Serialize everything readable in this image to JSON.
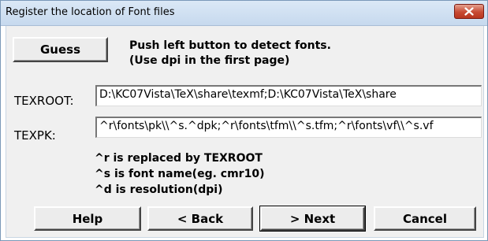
{
  "window": {
    "title": "Register the location of Font files"
  },
  "guess": {
    "button_label": "Guess",
    "hint_line1": "Push left button to detect fonts.",
    "hint_line2": "(Use dpi in the first page)"
  },
  "texroot": {
    "label": "TEXROOT:",
    "value": "D:\\KC07Vista\\TeX\\share\\texmf;D:\\KC07Vista\\TeX\\share"
  },
  "texpk": {
    "label": "TEXPK:",
    "value": "^r\\fonts\\pk\\\\^s.^dpk;^r\\fonts\\tfm\\\\^s.tfm;^r\\fonts\\vf\\\\^s.vf"
  },
  "notes": {
    "line1": "^r is replaced by TEXROOT",
    "line2": "^s is font name(eg. cmr10)",
    "line3": "^d is resolution(dpi)"
  },
  "footer": {
    "help_label": "Help",
    "back_label": "< Back",
    "next_label": "> Next",
    "cancel_label": "Cancel"
  },
  "colors": {
    "close_button": "#c74a33",
    "titlebar": "#c6d9ee"
  },
  "icons": {
    "close": "close-icon"
  }
}
